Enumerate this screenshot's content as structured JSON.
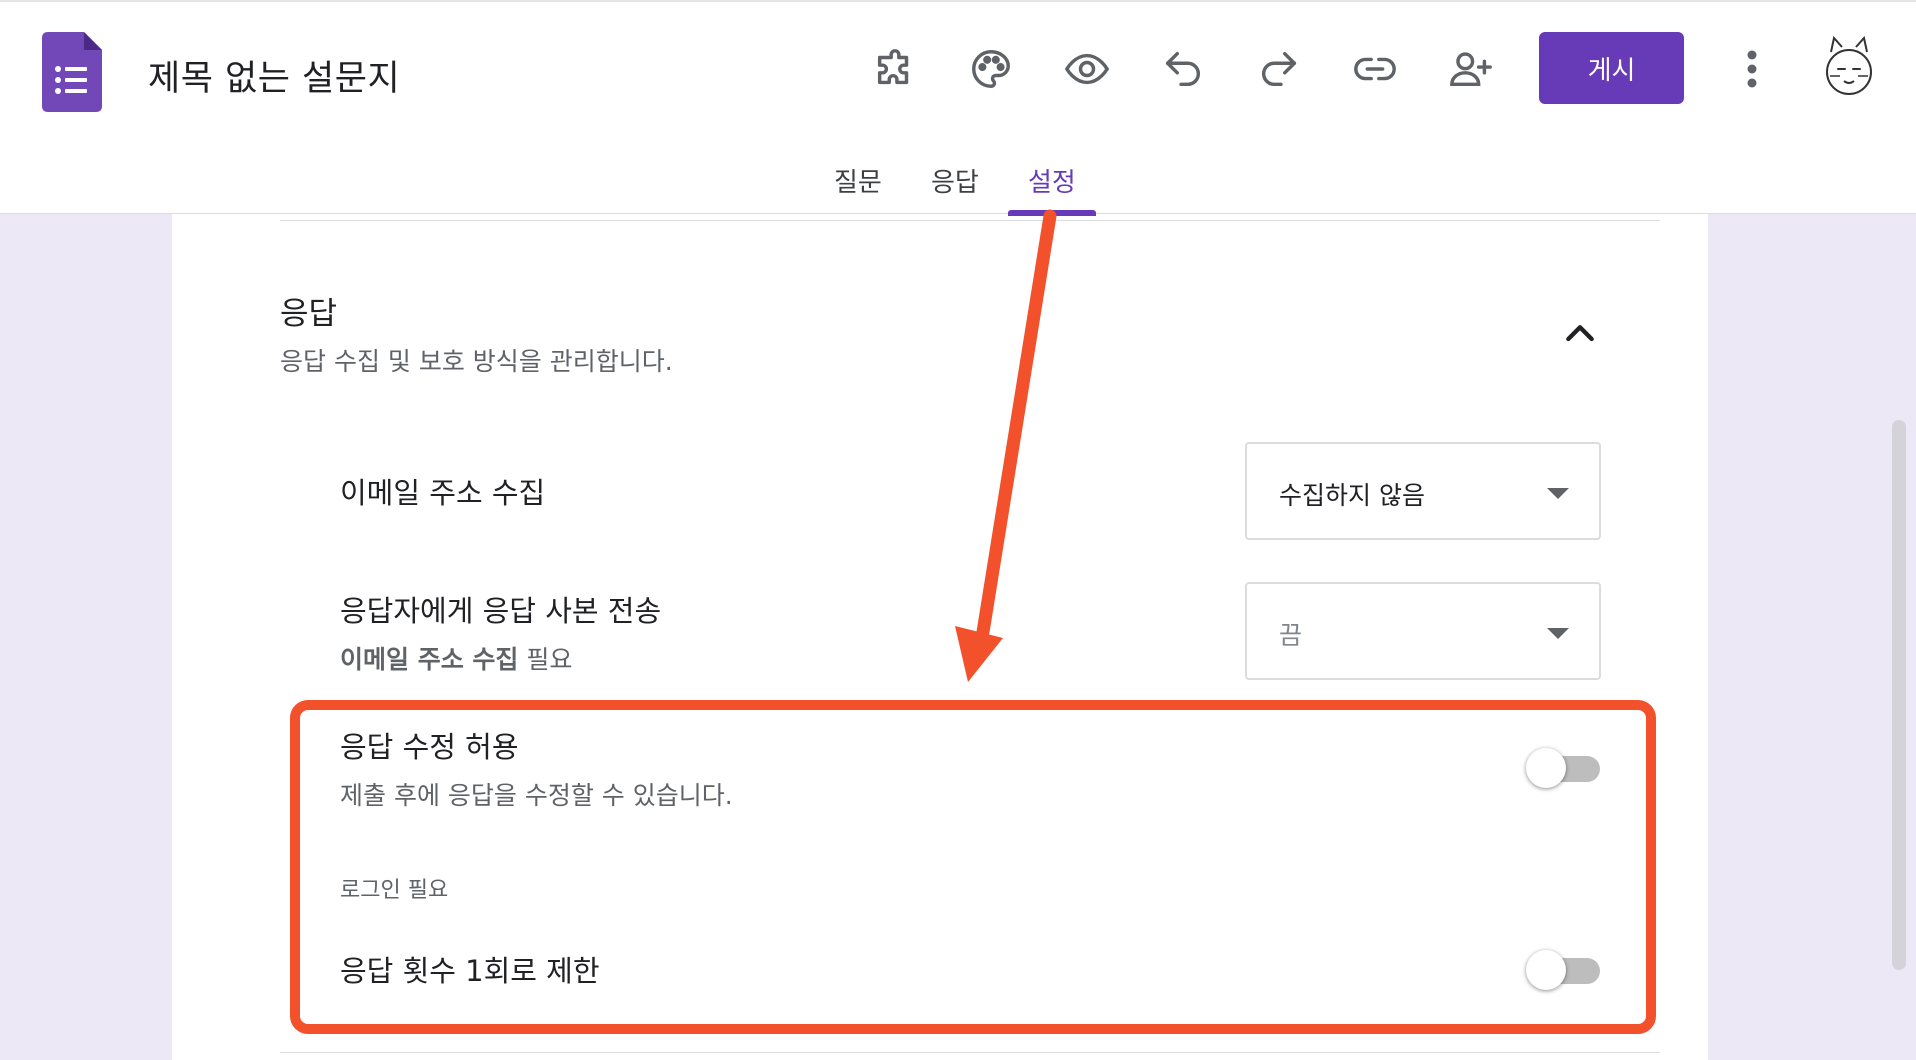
{
  "header": {
    "title": "제목 없는 설문지",
    "publish_label": "게시",
    "icons": [
      "puzzle-icon",
      "palette-icon",
      "eye-icon",
      "undo-icon",
      "redo-icon",
      "link-icon",
      "add-person-icon",
      "more-vert-icon",
      "avatar"
    ]
  },
  "tabs": [
    {
      "label": "질문",
      "active": false
    },
    {
      "label": "응답",
      "active": false
    },
    {
      "label": "설정",
      "active": true
    }
  ],
  "section": {
    "title": "응답",
    "description": "응답 수집 및 보호 방식을 관리합니다."
  },
  "settings": {
    "collect_email": {
      "label": "이메일 주소 수집",
      "value": "수집하지 않음"
    },
    "send_copy": {
      "label": "응답자에게 응답 사본 전송",
      "requirement_bold": "이메일 주소 수집",
      "requirement_suffix": " 필요",
      "value": "끔"
    },
    "allow_edit": {
      "label": "응답 수정 허용",
      "description": "제출 후에 응답을 수정할 수 있습니다.",
      "enabled": false
    },
    "login_group": {
      "label": "로그인 필요"
    },
    "limit_one": {
      "label": "응답 횟수 1회로 제한",
      "enabled": false
    }
  },
  "colors": {
    "brand": "#673ab7",
    "annotation": "#f3512b",
    "background": "#ece8f6"
  }
}
